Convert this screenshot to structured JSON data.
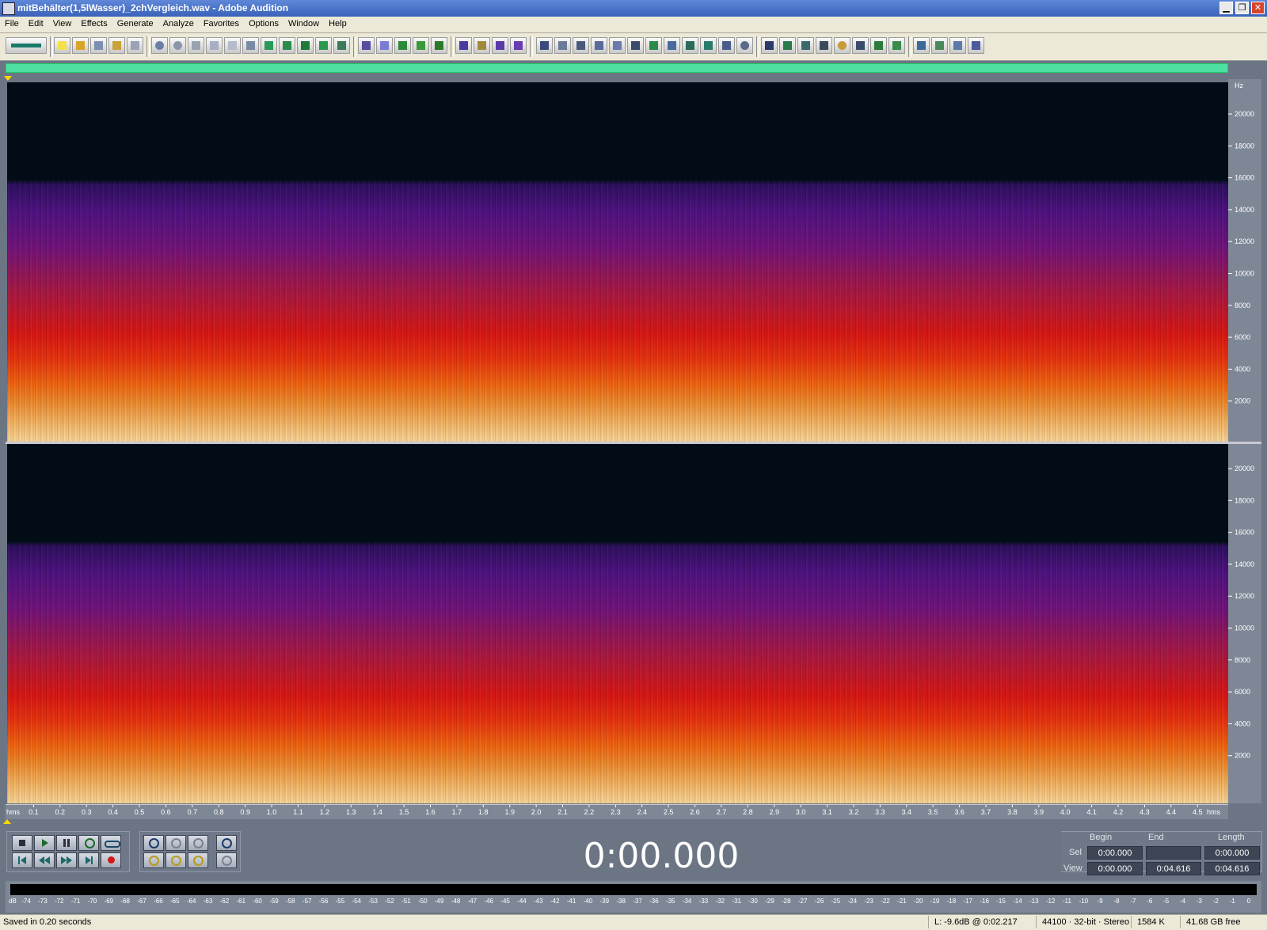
{
  "window": {
    "title": "mitBehälter(1,5lWasser)_2chVergleich.wav - Adobe Audition"
  },
  "menu": [
    "File",
    "Edit",
    "View",
    "Effects",
    "Generate",
    "Analyze",
    "Favorites",
    "Options",
    "Window",
    "Help"
  ],
  "freq_axis": {
    "unit": "Hz",
    "ticks": [
      "20000",
      "18000",
      "16000",
      "14000",
      "12000",
      "10000",
      "8000",
      "6000",
      "4000",
      "2000"
    ]
  },
  "time_axis": {
    "unit": "hms",
    "ticks": [
      "0.1",
      "0.2",
      "0.3",
      "0.4",
      "0.5",
      "0.6",
      "0.7",
      "0.8",
      "0.9",
      "1.0",
      "1.1",
      "1.2",
      "1.3",
      "1.4",
      "1.5",
      "1.6",
      "1.7",
      "1.8",
      "1.9",
      "2.0",
      "2.1",
      "2.2",
      "2.3",
      "2.4",
      "2.5",
      "2.6",
      "2.7",
      "2.8",
      "2.9",
      "3.0",
      "3.1",
      "3.2",
      "3.3",
      "3.4",
      "3.5",
      "3.6",
      "3.7",
      "3.8",
      "3.9",
      "4.0",
      "4.1",
      "4.2",
      "4.3",
      "4.4",
      "4.5"
    ]
  },
  "time_display": "0:00.000",
  "selection": {
    "headers": {
      "begin": "Begin",
      "end": "End",
      "length": "Length"
    },
    "sel": {
      "label": "Sel",
      "begin": "0:00.000",
      "end": "",
      "length": "0:00.000"
    },
    "view": {
      "label": "View",
      "begin": "0:00.000",
      "end": "0:04.616",
      "length": "0:04.616"
    }
  },
  "level_meter": {
    "unit": "dB",
    "ticks": [
      "-74",
      "-73",
      "-72",
      "-71",
      "-70",
      "-69",
      "-68",
      "-67",
      "-66",
      "-65",
      "-64",
      "-63",
      "-62",
      "-61",
      "-60",
      "-59",
      "-58",
      "-57",
      "-56",
      "-55",
      "-54",
      "-53",
      "-52",
      "-51",
      "-50",
      "-49",
      "-48",
      "-47",
      "-46",
      "-45",
      "-44",
      "-43",
      "-42",
      "-41",
      "-40",
      "-39",
      "-38",
      "-37",
      "-36",
      "-35",
      "-34",
      "-33",
      "-32",
      "-31",
      "-30",
      "-29",
      "-28",
      "-27",
      "-26",
      "-25",
      "-24",
      "-23",
      "-22",
      "-21",
      "-20",
      "-19",
      "-18",
      "-17",
      "-16",
      "-15",
      "-14",
      "-13",
      "-12",
      "-11",
      "-10",
      "-9",
      "-8",
      "-7",
      "-6",
      "-5",
      "-4",
      "-3",
      "-2",
      "-1",
      "0"
    ]
  },
  "status": {
    "message": "Saved in 0.20 seconds",
    "cursor": "L: -9.6dB @  0:02.217",
    "format": "44100 · 32-bit · Stereo",
    "size": "1584 K",
    "free": "41.68 GB free"
  }
}
